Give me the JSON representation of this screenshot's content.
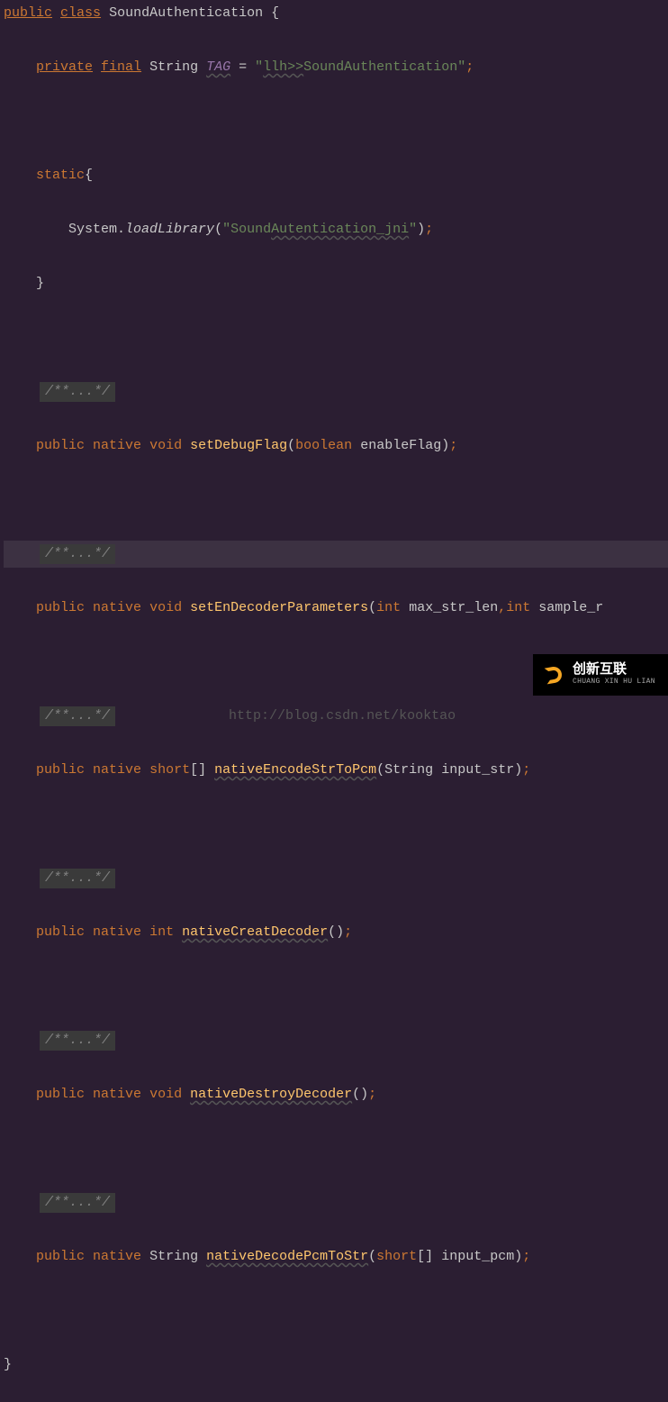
{
  "kw": {
    "public": "public",
    "class": "class",
    "private": "private",
    "final": "final",
    "static": "static",
    "native": "native",
    "void": "void",
    "boolean": "boolean",
    "int": "int",
    "short": "short"
  },
  "cls": "SoundAuthentication",
  "fld": "TAG",
  "tagStr": {
    "q1": "\"",
    "p1": "llh>>",
    "p2": "SoundAuthentication",
    "q2": "\""
  },
  "typeString": "String",
  "sys": "System.",
  "loadLib": "loadLibrary",
  "libStr": {
    "q1": "\"",
    "p1": "Sound",
    "p2": "Autentication_jni",
    "q2": "\""
  },
  "comment": "/**...*/",
  "methods": {
    "m1": "setDebugFlag",
    "m2": "setEnDecoderParameters",
    "m3": "nativeEncodeStrToPcm",
    "m4": "nativeCreatDecoder",
    "m5": "nativeDestroyDecoder",
    "m6": "nativeDecodePcmToStr"
  },
  "params": {
    "enableFlag": "enableFlag",
    "maxStrLen": "max_str_len",
    "sampleR": "sample_r",
    "inputStr": "input_str",
    "inputPcm": "input_pcm"
  },
  "brackets": "[]",
  "watermark": "http://blog.csdn.net/kooktao",
  "badge": {
    "cn": "创新互联",
    "en": "CHUANG XIN HU LIAN"
  }
}
